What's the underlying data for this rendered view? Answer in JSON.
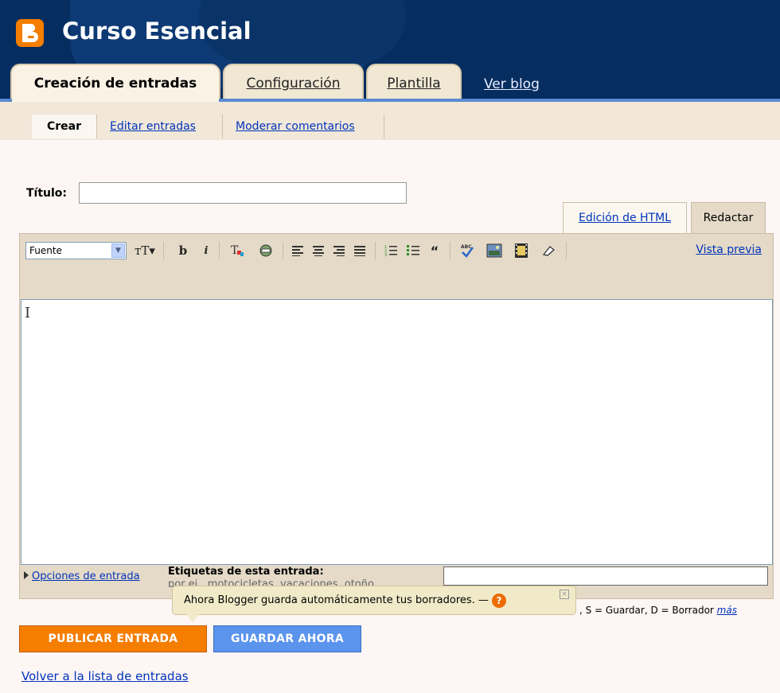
{
  "header": {
    "blog_title": "Curso Esencial",
    "tabs": [
      {
        "label": "Creación de entradas"
      },
      {
        "label": "Configuración"
      },
      {
        "label": "Plantilla"
      }
    ],
    "view_blog": "Ver blog"
  },
  "subnav": {
    "items": [
      {
        "label": "Crear"
      },
      {
        "label": "Editar entradas"
      },
      {
        "label": "Moderar comentarios"
      }
    ]
  },
  "post": {
    "title_label": "Título:",
    "title_value": ""
  },
  "editor": {
    "mode_html": "Edición de HTML",
    "mode_compose": "Redactar",
    "font_select": "Fuente",
    "preview": "Vista previa",
    "content": ""
  },
  "options": {
    "toggle": "Opciones de entrada",
    "labels_label": "Etiquetas de esta entrada:",
    "labels_example": "por ej., motocicletas, vacaciones, otoño"
  },
  "tooltip": {
    "text": "Ahora Blogger guarda automáticamente tus borradores. —"
  },
  "shortcuts": {
    "text": ", S = Guardar, D = Borrador",
    "more": "más"
  },
  "buttons": {
    "publish": "PUBLICAR ENTRADA",
    "save": "GUARDAR AHORA"
  },
  "back_link": "Volver a la lista de entradas",
  "colors": {
    "header_bg": "#062d60",
    "tab_bg": "#f1e8d4",
    "publish_btn": "#f57d00",
    "save_btn": "#5b94ec",
    "link": "#0033bb"
  }
}
